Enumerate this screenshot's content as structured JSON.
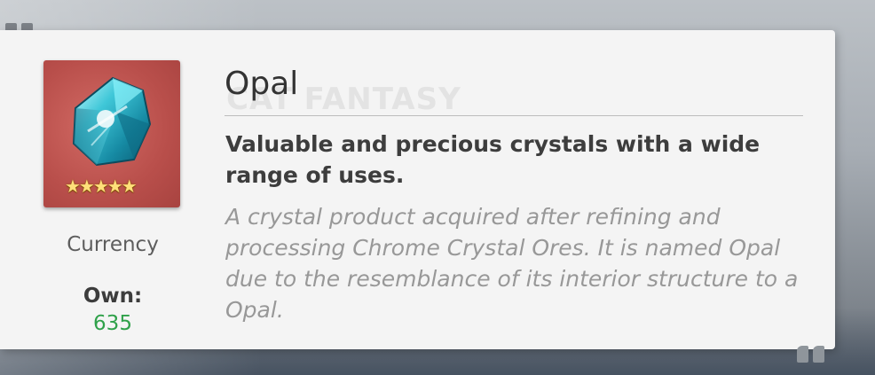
{
  "item": {
    "name": "Opal",
    "rarity_stars": "★★★★★",
    "category": "Currency",
    "own_label": "Own:",
    "own_count": "635",
    "short_desc": "Valuable and precious crystals with a wide range of uses.",
    "lore": "A crystal product acquired after refining and processing Chrome Crystal Ores. It is named Opal due to the resemblance of its interior structure to a Opal.",
    "icon": "opal-crystal-icon",
    "frame_color": "#b94f4b"
  },
  "watermark": "CAT FANTASY",
  "colors": {
    "own_value": "#2fa14a",
    "lore_text": "#989898",
    "card_bg": "#f4f4f4"
  }
}
